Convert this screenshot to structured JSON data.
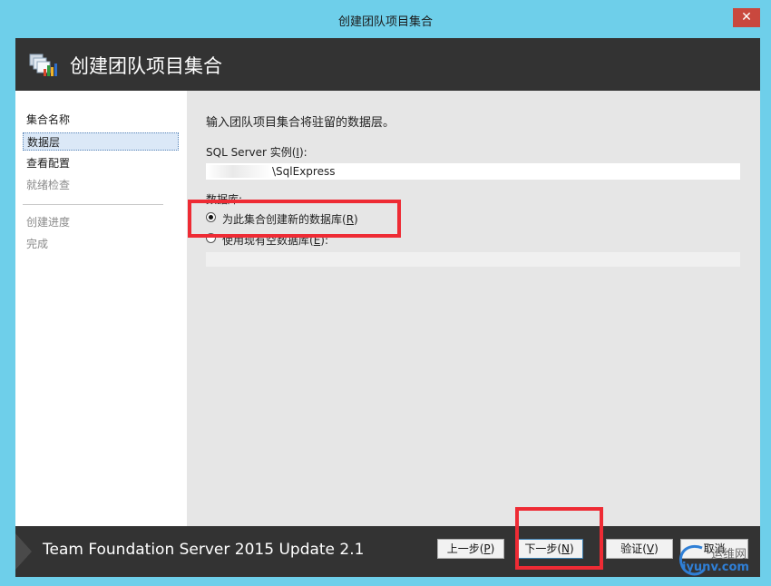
{
  "window": {
    "title": "创建团队项目集合",
    "close_glyph": "✕"
  },
  "header": {
    "title": "创建团队项目集合",
    "icon": "tfs-collection-icon"
  },
  "nav": {
    "items": [
      {
        "label": "集合名称",
        "state": "normal"
      },
      {
        "label": "数据层",
        "state": "selected"
      },
      {
        "label": "查看配置",
        "state": "normal"
      },
      {
        "label": "就绪检查",
        "state": "disabled"
      },
      {
        "label": "创建进度",
        "state": "disabled"
      },
      {
        "label": "完成",
        "state": "disabled"
      }
    ]
  },
  "content": {
    "intro": "输入团队项目集合将驻留的数据层。",
    "sql_label_prefix": "SQL Server 实例(",
    "sql_label_key": "I",
    "sql_label_suffix": "):",
    "sql_value": "\\SqlExpress",
    "database_label": "数据库:",
    "options": [
      {
        "prefix": "为此集合创建新的数据库(",
        "key": "R",
        "suffix": ")",
        "checked": true
      },
      {
        "prefix": "使用现有空数据库(",
        "key": "E",
        "suffix": "):",
        "checked": false
      }
    ]
  },
  "footer": {
    "product": "Team Foundation Server 2015 Update 2.1",
    "buttons": {
      "back": {
        "prefix": "上一步(",
        "key": "P",
        "suffix": ")"
      },
      "next": {
        "prefix": "下一步(",
        "key": "N",
        "suffix": ")"
      },
      "verify": {
        "prefix": "验证(",
        "key": "V",
        "suffix": ")"
      },
      "cancel": "取消"
    }
  },
  "watermark": {
    "top": "运维网",
    "bottom": "iyunv.com"
  },
  "colors": {
    "frame": "#6ecfea",
    "header_bg": "#333333",
    "content_bg": "#e6e6e6",
    "annotation": "#ee2b34",
    "selected_nav": "#dbe8f7"
  }
}
